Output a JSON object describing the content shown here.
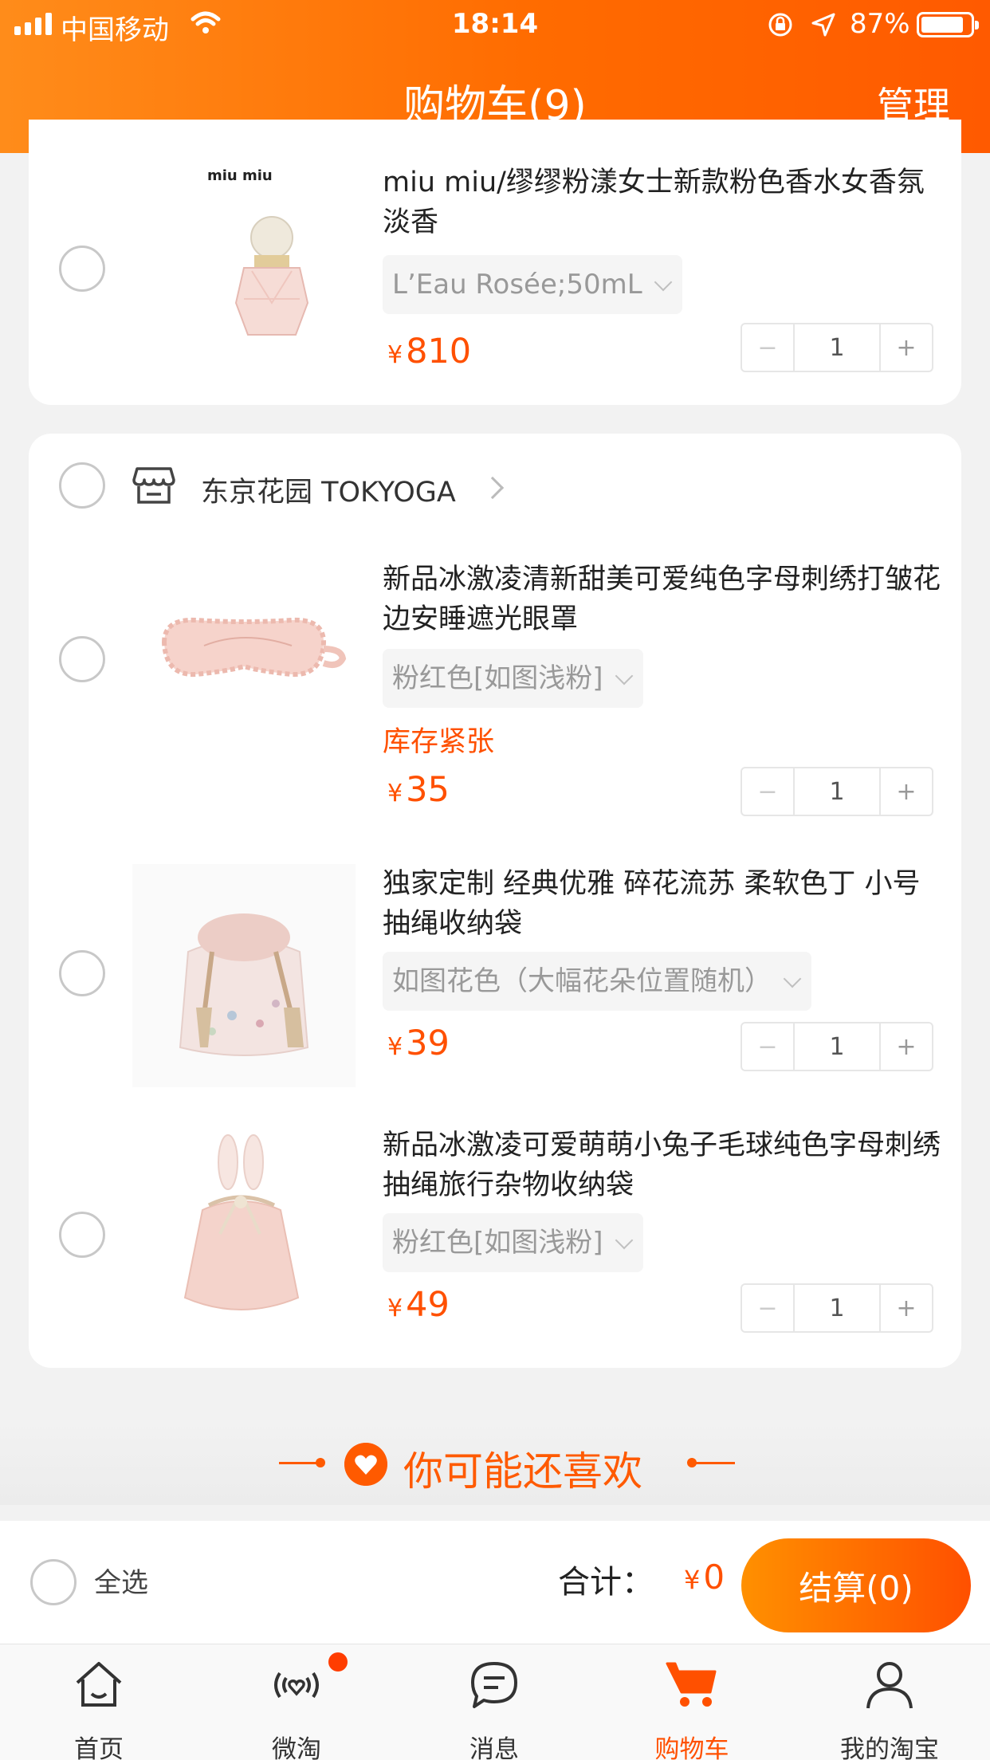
{
  "status_bar": {
    "carrier": "中国移动",
    "time": "18:14",
    "battery": "87%",
    "battery_level": 0.87
  },
  "nav": {
    "title": "购物车(9)",
    "manage": "管理"
  },
  "previous_item": {
    "brand_logo_text": "miu miu",
    "title": "miu miu/缪缪粉漾女士新款粉色香水女香氛淡香",
    "spec": "L’Eau Rosée;50mL",
    "currency": "¥",
    "price": "810",
    "qty": "1"
  },
  "shop": {
    "name": "东京花园 TOKYOGA",
    "items": [
      {
        "title": "新品冰激凌清新甜美可爱纯色字母刺绣打皱花边安睡遮光眼罩",
        "spec": "粉红色[如图浅粉]",
        "warning": "库存紧张",
        "currency": "¥",
        "price": "35",
        "qty": "1"
      },
      {
        "title": "独家定制 经典优雅 碎花流苏 柔软色丁 小号抽绳收纳袋",
        "spec": "如图花色（大幅花朵位置随机）",
        "currency": "¥",
        "price": "39",
        "qty": "1"
      },
      {
        "title": "新品冰激凌可爱萌萌小兔子毛球纯色字母刺绣抽绳旅行杂物收纳袋",
        "spec": "粉红色[如图浅粉]",
        "currency": "¥",
        "price": "49",
        "qty": "1"
      }
    ]
  },
  "recommend": {
    "title": "你可能还喜欢"
  },
  "checkout": {
    "select_all": "全选",
    "total_label": "合计：",
    "currency": "¥",
    "total": "0",
    "button": "结算(0)"
  },
  "qty_controls": {
    "minus": "−",
    "plus": "+"
  },
  "tabs": [
    {
      "label": "首页",
      "icon": "home-icon"
    },
    {
      "label": "微淘",
      "icon": "weitao-icon"
    },
    {
      "label": "消息",
      "icon": "message-icon"
    },
    {
      "label": "购物车",
      "icon": "cart-icon",
      "active": true
    },
    {
      "label": "我的淘宝",
      "icon": "profile-icon"
    }
  ],
  "colors": {
    "accent": "#ff5000",
    "header_start": "#ff8c1a",
    "header_end": "#ff5a00"
  }
}
